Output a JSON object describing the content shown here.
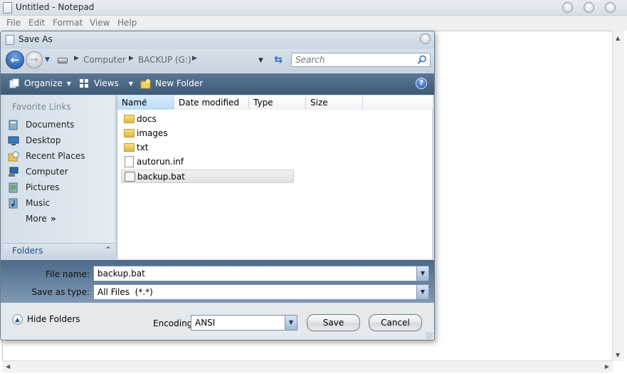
{
  "notepad": {
    "title": "Untitled - Notepad",
    "menu": [
      "File",
      "Edit",
      "Format",
      "View",
      "Help"
    ]
  },
  "dialog": {
    "title": "Save As",
    "breadcrumb": [
      "Computer",
      "BACKUP (G:)"
    ],
    "search_placeholder": "Search",
    "toolbar": {
      "organize": "Organize",
      "views": "Views",
      "new_folder": "New Folder"
    },
    "favorites": {
      "title": "Favorite Links",
      "items": [
        {
          "label": "Documents",
          "icon": "documents-icon"
        },
        {
          "label": "Desktop",
          "icon": "desktop-icon"
        },
        {
          "label": "Recent Places",
          "icon": "recent-places-icon"
        },
        {
          "label": "Computer",
          "icon": "computer-icon"
        },
        {
          "label": "Pictures",
          "icon": "pictures-icon"
        },
        {
          "label": "Music",
          "icon": "music-icon"
        }
      ],
      "more": "More"
    },
    "folders_label": "Folders",
    "columns": [
      "Name",
      "Date modified",
      "Type",
      "Size"
    ],
    "files": [
      {
        "name": "docs",
        "kind": "folder"
      },
      {
        "name": "images",
        "kind": "folder"
      },
      {
        "name": "txt",
        "kind": "folder"
      },
      {
        "name": "autorun.inf",
        "kind": "file"
      },
      {
        "name": "backup.bat",
        "kind": "batch",
        "selected": true
      }
    ],
    "file_name_label": "File name:",
    "file_name_value": "backup.bat",
    "save_type_label": "Save as type:",
    "save_type_value": "All Files  (*.*)",
    "hide_folders": "Hide Folders",
    "encoding_label": "Encoding:",
    "encoding_value": "ANSI",
    "save_button": "Save",
    "cancel_button": "Cancel"
  },
  "colors": {
    "toolbar": "#4a6786",
    "accent_blue": "#1c4f9c",
    "folder_yellow": "#e2b640"
  }
}
